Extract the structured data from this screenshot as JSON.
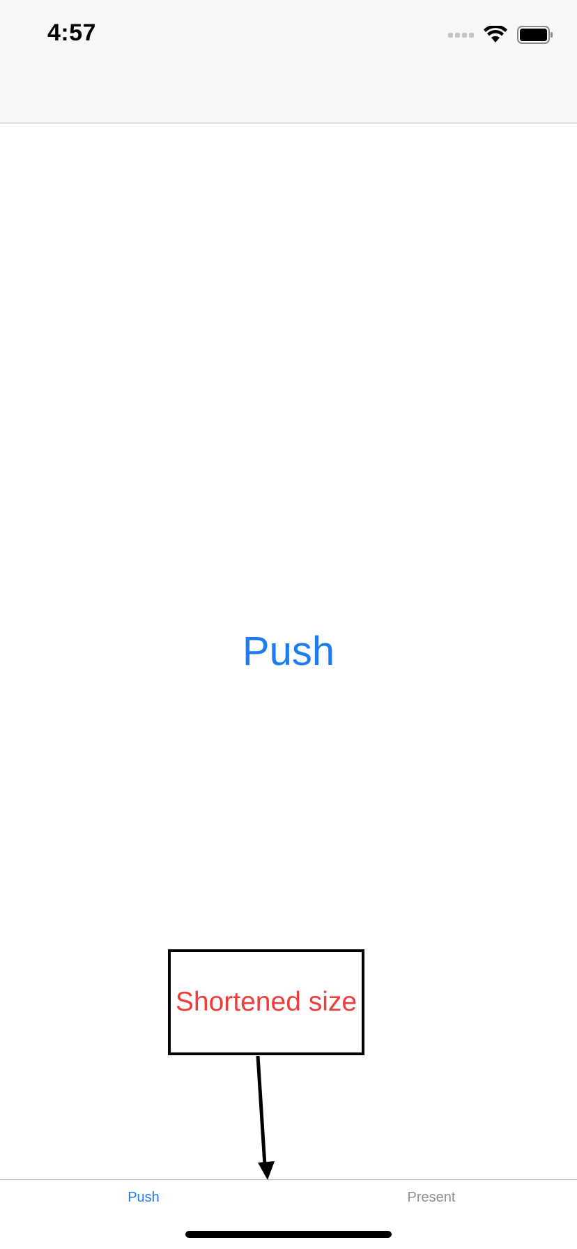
{
  "status_bar": {
    "time": "4:57",
    "signal_icon": "cellular-signal-icon",
    "wifi_icon": "wifi-icon",
    "battery_icon": "battery-icon"
  },
  "main": {
    "push_button_label": "Push"
  },
  "annotation": {
    "label": "Shortened size",
    "arrow_icon": "arrow-down-icon"
  },
  "tab_bar": {
    "tabs": [
      {
        "label": "Push",
        "selected": true
      },
      {
        "label": "Present",
        "selected": false
      }
    ]
  },
  "colors": {
    "accent": "#1e7cf2",
    "annotation_text": "#ee3d3a",
    "tab_inactive": "#8e8e93",
    "bar_background": "#f8f8f8"
  }
}
